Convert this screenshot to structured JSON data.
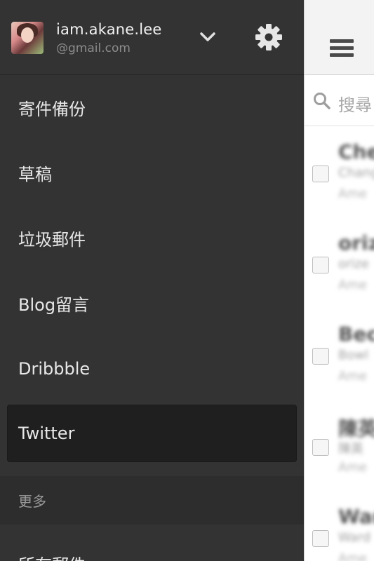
{
  "account": {
    "name": "iam.akane.lee",
    "domain": "@gmail.com",
    "icons": {
      "expand": "chevron-down-icon",
      "settings": "gear-icon"
    }
  },
  "menu": {
    "items": [
      {
        "label": "寄件備份",
        "selected": false
      },
      {
        "label": "草稿",
        "selected": false
      },
      {
        "label": "垃圾郵件",
        "selected": false
      },
      {
        "label": "Blog留言",
        "selected": false
      },
      {
        "label": "Dribbble",
        "selected": false
      },
      {
        "label": "Twitter",
        "selected": true
      }
    ],
    "section_more": "更多",
    "partial_item": "所有郵件"
  },
  "content": {
    "search_placeholder": "搜尋",
    "rows": [
      {
        "sender": "Che",
        "line1": "Chang",
        "line2": "Ame"
      },
      {
        "sender": "oriz",
        "line1": "orize",
        "line2": "Ame"
      },
      {
        "sender": "Beck",
        "line1": "Bowl",
        "line2": "Ame"
      },
      {
        "sender": "陳英",
        "line1": "陳英",
        "line2": "Ame"
      },
      {
        "sender": "Ward",
        "line1": "Ward",
        "line2": "Ame"
      }
    ]
  },
  "colors": {
    "drawer_bg": "#333333",
    "selected_bg": "#1f1f1f",
    "section_bg": "#2d2d2d",
    "topbar_bg": "#f3f3f3"
  }
}
